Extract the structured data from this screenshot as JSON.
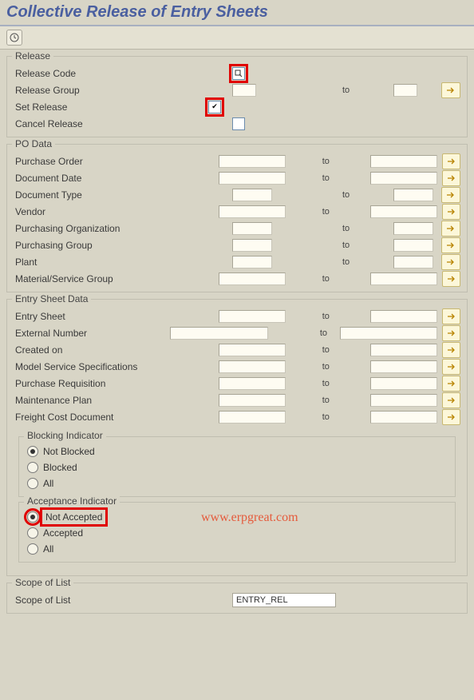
{
  "title": "Collective Release of Entry Sheets",
  "release": {
    "legend": "Release",
    "code_label": "Release Code",
    "group_label": "Release Group",
    "set_label": "Set Release",
    "cancel_label": "Cancel Release",
    "to": "to"
  },
  "po": {
    "legend": "PO Data",
    "rows": {
      "purchase_order": "Purchase Order",
      "document_date": "Document Date",
      "document_type": "Document Type",
      "vendor": "Vendor",
      "purchasing_org": "Purchasing Organization",
      "purchasing_group": "Purchasing Group",
      "plant": "Plant",
      "material_service_group": "Material/Service Group"
    },
    "to": "to"
  },
  "es": {
    "legend": "Entry Sheet Data",
    "rows": {
      "entry_sheet": "Entry Sheet",
      "external_number": "External Number",
      "created_on": "Created on",
      "model_service_spec": "Model Service Specifications",
      "purchase_req": "Purchase Requisition",
      "maintenance_plan": "Maintenance Plan",
      "freight_cost_doc": "Freight Cost Document"
    },
    "to": "to"
  },
  "blocking": {
    "legend": "Blocking Indicator",
    "not_blocked": "Not Blocked",
    "blocked": "Blocked",
    "all": "All"
  },
  "acceptance": {
    "legend": "Acceptance Indicator",
    "not_accepted": "Not Accepted",
    "accepted": "Accepted",
    "all": "All"
  },
  "scope": {
    "legend": "Scope of List",
    "label": "Scope of List",
    "value": "ENTRY_REL"
  },
  "watermark": "www.erpgreat.com"
}
